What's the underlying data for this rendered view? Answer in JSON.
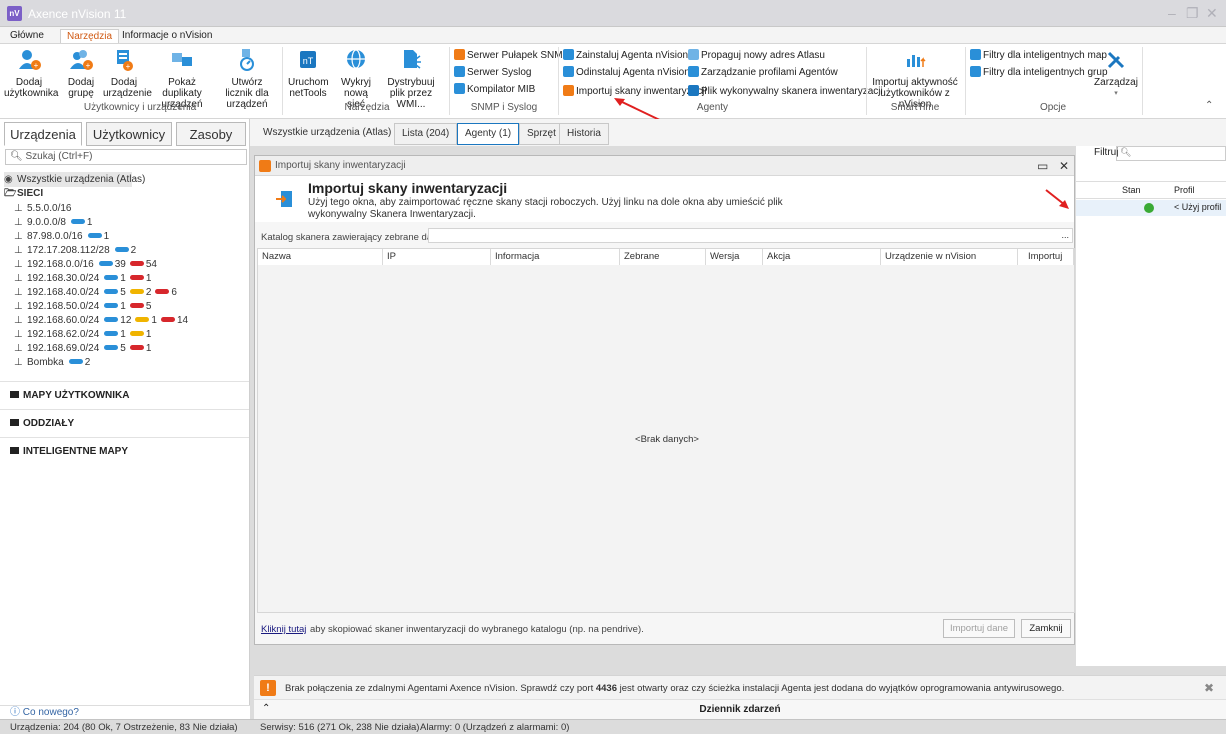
{
  "window": {
    "app_icon": "nV",
    "title": "Axence nVision 11"
  },
  "ribbon_tabs": [
    "Główne",
    "Narzędzia",
    "Informacje o nVision"
  ],
  "ribbon": {
    "users_group": {
      "label": "Użytkownicy i urządzenia",
      "buttons": [
        "Dodaj użytkownika",
        "Dodaj grupę",
        "Dodaj urządzenie",
        "Pokaż duplikaty urządzeń",
        "Utwórz licznik dla urządzeń"
      ]
    },
    "tools_group": {
      "label": "Narzędzia",
      "buttons": [
        "Uruchom netTools",
        "Wykryj nową sieć",
        "Dystrybuuj plik przez WMI..."
      ]
    },
    "snmp_group": {
      "label": "SNMP i Syslog",
      "buttons": [
        "Serwer Pułapek SNMP",
        "Serwer Syslog",
        "Kompilator MIB"
      ]
    },
    "agents_group": {
      "label": "Agenty",
      "buttons": [
        "Zainstaluj Agenta nVision",
        "Odinstaluj Agenta nVision",
        "Importuj skany inwentaryzacji",
        "Propaguj nowy adres Atlasu",
        "Zarządzanie profilami Agentów",
        "Plik wykonywalny skanera inwentaryzacji"
      ]
    },
    "smarttime_group": {
      "label": "SmartTime",
      "button": "Importuj aktywność użytkowników z nVision"
    },
    "options_group": {
      "label": "Opcje",
      "buttons": [
        "Filtry dla inteligentnych map",
        "Filtry dla inteligentnych grup",
        "Zarządzaj"
      ]
    }
  },
  "left_tabs": [
    "Urządzenia",
    "Użytkownicy",
    "Zasoby"
  ],
  "search": {
    "placeholder": "Szukaj (Ctrl+F)"
  },
  "tree": {
    "root": "Wszystkie urządzenia (Atlas)",
    "networks_label": "SIECI",
    "networks": [
      {
        "name": "5.5.0.0/16",
        "ok": "",
        "warn": "",
        "down": ""
      },
      {
        "name": "9.0.0.0/8",
        "ok": "1",
        "warn": "",
        "down": ""
      },
      {
        "name": "87.98.0.0/16",
        "ok": "1",
        "warn": "",
        "down": ""
      },
      {
        "name": "172.17.208.112/28",
        "ok": "2",
        "warn": "",
        "down": ""
      },
      {
        "name": "192.168.0.0/16",
        "ok": "39",
        "warn": "",
        "down": "54"
      },
      {
        "name": "192.168.30.0/24",
        "ok": "1",
        "warn": "",
        "down": "1"
      },
      {
        "name": "192.168.40.0/24",
        "ok": "5",
        "warn": "2",
        "down": "6"
      },
      {
        "name": "192.168.50.0/24",
        "ok": "1",
        "warn": "",
        "down": "5"
      },
      {
        "name": "192.168.60.0/24",
        "ok": "12",
        "warn": "1",
        "down": "14"
      },
      {
        "name": "192.168.62.0/24",
        "ok": "1",
        "warn": "1",
        "down": ""
      },
      {
        "name": "192.168.69.0/24",
        "ok": "5",
        "warn": "",
        "down": "1"
      },
      {
        "name": "Bombka",
        "ok": "2",
        "warn": "",
        "down": ""
      }
    ],
    "sections": [
      "MAPY UŻYTKOWNIKA",
      "ODDZIAŁY",
      "INTELIGENTNE MAPY"
    ]
  },
  "whats_new": "Co nowego?",
  "main_tabs": [
    "Wszystkie urządzenia (Atlas)",
    "Lista (204)",
    "Agenty (1)",
    "Sprzęt",
    "Historia"
  ],
  "right_panel": {
    "filter_label": "Filtruj",
    "columns": [
      "Stan",
      "Profil"
    ],
    "profile_value": "< Użyj profil",
    "status_color": "#3aaa35"
  },
  "dialog": {
    "title": "Importuj skany inwentaryzacji",
    "heading": "Importuj skany inwentaryzacji",
    "description": "Użyj tego okna, aby zaimportować ręczne skany stacji roboczych. Użyj linku na dole okna aby umieścić plik wykonywalny Skanera Inwentaryzacji.",
    "catalog_label": "Katalog skanera zawierający zebrane dane:",
    "browse_label": "...",
    "columns": [
      "Nazwa",
      "IP",
      "Informacja",
      "Zebrane",
      "Wersja",
      "Akcja",
      "Urządzenie w nVision",
      "Importuj"
    ],
    "no_data": "<Brak danych>",
    "copy_link": "Kliknij tutaj",
    "copy_text": "aby skopiować skaner inwentaryzacji do wybranego katalogu (np. na pendrive).",
    "import_button": "Importuj dane",
    "close_button": "Zamknij"
  },
  "alert": {
    "icon": "!",
    "text_before": "Brak połączenia ze zdalnymi Agentami Axence nVision. Sprawdź czy port",
    "port": "4436",
    "text_after": "jest otwarty oraz czy ścieżka instalacji Agenta jest dodana do wyjątków oprogramowania antywirusowego."
  },
  "event_log": {
    "label": "Dziennik zdarzeń"
  },
  "status_bar": {
    "devices": "Urządzenia: 204 (80 Ok, 7 Ostrzeżenie, 83 Nie działa)",
    "services": "Serwisy: 516 (271 Ok, 238 Nie działa)",
    "alarms": "Alarmy: 0 (Urządzeń z alarmami: 0)"
  },
  "colors": {
    "accent": "#d05a14",
    "ok": "#2a8fd8",
    "down": "#d7272c",
    "warn": "#f0b400"
  }
}
